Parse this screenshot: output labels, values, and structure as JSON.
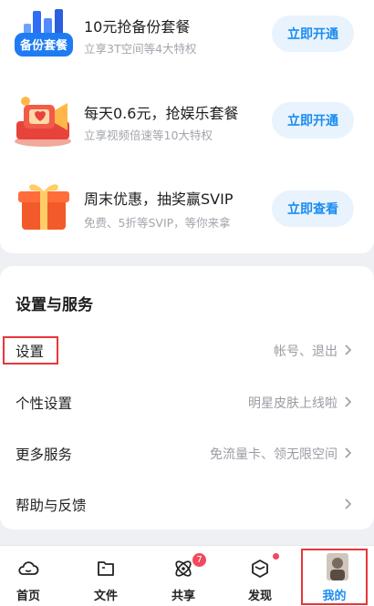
{
  "promos": [
    {
      "title": "10元抢备份套餐",
      "subtitle": "立享3T空间等4大特权",
      "cta": "立即开通",
      "thumb_text": "备份套餐",
      "icon": "backup-package-icon"
    },
    {
      "title": "每天0.6元，抢娱乐套餐",
      "subtitle": "立享视频倍速等10大特权",
      "cta": "立即开通",
      "icon": "entertainment-package-icon"
    },
    {
      "title": "周末优惠，抽奖赢SVIP",
      "subtitle": "免费、5折等SVIP，等你来拿",
      "cta": "立即查看",
      "icon": "gift-box-icon"
    }
  ],
  "settings": {
    "title": "设置与服务",
    "rows": [
      {
        "label": "设置",
        "hint": "帐号、退出"
      },
      {
        "label": "个性设置",
        "hint": "明星皮肤上线啦"
      },
      {
        "label": "更多服务",
        "hint": "免流量卡、领无限空间"
      },
      {
        "label": "帮助与反馈",
        "hint": ""
      }
    ]
  },
  "nav": {
    "items": [
      {
        "label": "首页",
        "icon": "cloud-icon"
      },
      {
        "label": "文件",
        "icon": "folder-icon"
      },
      {
        "label": "共享",
        "icon": "atom-icon",
        "badge": "7"
      },
      {
        "label": "发现",
        "icon": "cube-icon"
      },
      {
        "label": "我的",
        "icon": "avatar"
      }
    ]
  },
  "colors": {
    "accent": "#1a8cf0",
    "highlight": "#e8363a",
    "badge": "#f24860"
  }
}
